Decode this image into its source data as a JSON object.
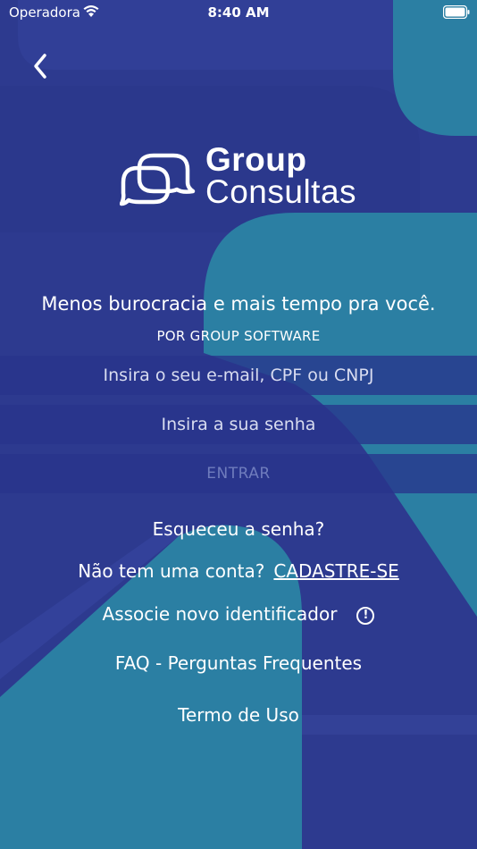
{
  "status_bar": {
    "carrier": "Operadora",
    "time": "8:40 AM"
  },
  "logo": {
    "line1": "Group",
    "line2": "Consultas"
  },
  "tagline": "Menos burocracia e mais tempo pra você.",
  "byline": "POR GROUP SOFTWARE",
  "form": {
    "email_placeholder": "Insira o seu e-mail, CPF ou CNPJ",
    "password_placeholder": "Insira a sua senha",
    "submit_label": "ENTRAR"
  },
  "links": {
    "forgot_password": "Esqueceu a senha?",
    "no_account_prompt": "Não tem uma conta?",
    "signup": "CADASTRE-SE",
    "associate_identifier": "Associe novo identificador",
    "faq": "FAQ - Perguntas Frequentes",
    "terms": "Termo de Uso"
  },
  "colors": {
    "primary": "#2d3a8f",
    "secondary": "#2b7fa3",
    "text": "#ffffff"
  }
}
